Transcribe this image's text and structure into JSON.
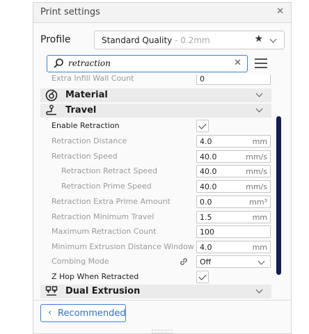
{
  "panel": {
    "title": "Print settings"
  },
  "profile": {
    "label": "Profile",
    "name": "Standard Quality",
    "suffix": " - 0.2mm"
  },
  "search": {
    "value": "retraction"
  },
  "settings": {
    "partial_row": {
      "label": "Extra Infill Wall Count",
      "value": "0"
    },
    "categories": {
      "material": "Material",
      "travel": "Travel",
      "dual": "Dual Extrusion"
    },
    "rows": [
      {
        "label": "Enable Retraction",
        "checked": true
      },
      {
        "label": "Retraction Distance",
        "value": "4.0",
        "unit": "mm"
      },
      {
        "label": "Retraction Speed",
        "value": "40.0",
        "unit": "mm/s"
      },
      {
        "label": "Retraction Retract Speed",
        "value": "40.0",
        "unit": "mm/s"
      },
      {
        "label": "Retraction Prime Speed",
        "value": "40.0",
        "unit": "mm/s"
      },
      {
        "label": "Retraction Extra Prime Amount",
        "value": "0.0",
        "unit": "mm³"
      },
      {
        "label": "Retraction Minimum Travel",
        "value": "1.5",
        "unit": "mm"
      },
      {
        "label": "Maximum Retraction Count",
        "value": "100"
      },
      {
        "label": "Minimum Extrusion Distance Window",
        "value": "4.0",
        "unit": "mm"
      },
      {
        "label": "Combing Mode",
        "value": "Off"
      },
      {
        "label": "Z Hop When Retracted",
        "checked": true
      }
    ]
  },
  "footer": {
    "recommended_label": "Recommended"
  },
  "colors": {
    "accent": "#3a7ddc",
    "scrollbar": "#0f1d52"
  }
}
